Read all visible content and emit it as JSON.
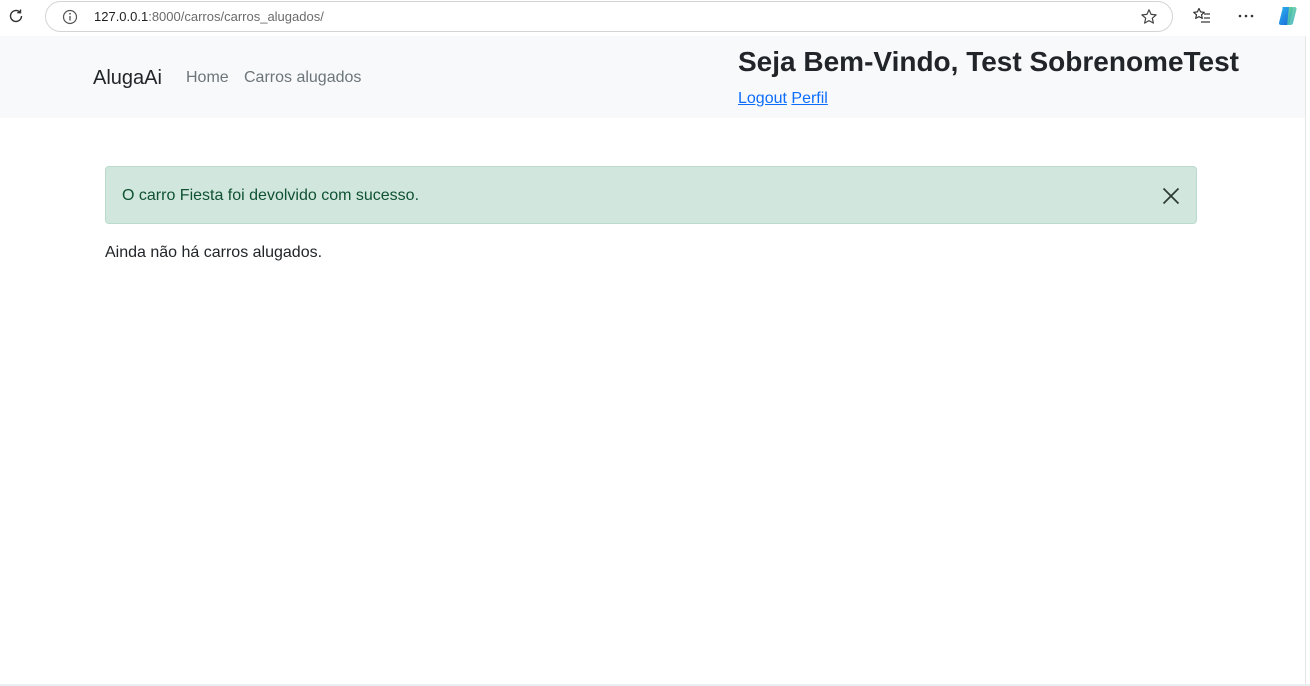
{
  "browser": {
    "url_host": "127.0.0.1",
    "url_rest": ":8000/carros/carros_alugados/"
  },
  "navbar": {
    "brand": "AlugaAi",
    "links": [
      {
        "label": "Home"
      },
      {
        "label": "Carros alugados"
      }
    ],
    "welcome": "Seja Bem-Vindo, Test SobrenomeTest",
    "logout_label": "Logout",
    "profile_label": "Perfil"
  },
  "alert": {
    "message": "O carro Fiesta foi devolvido com sucesso."
  },
  "main": {
    "empty_message": "Ainda não há carros alugados."
  },
  "colors": {
    "alert_bg": "#d1e7dd",
    "alert_text": "#0f5132",
    "link": "#0d6efd",
    "navbar_bg": "#f8f9fa"
  }
}
